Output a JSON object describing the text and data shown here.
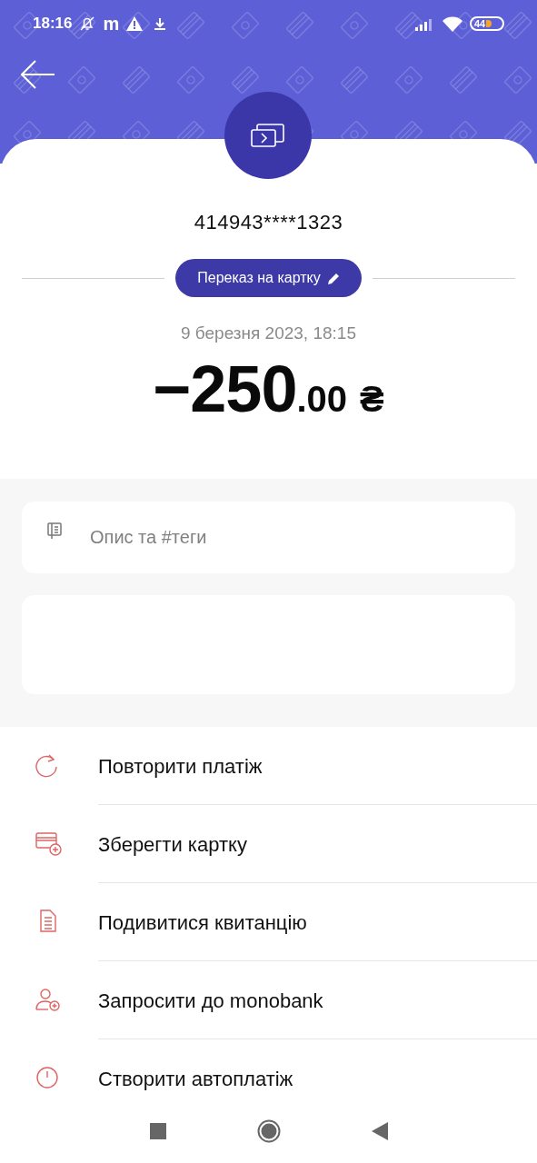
{
  "status_bar": {
    "time": "18:16",
    "notification_letter": "m",
    "battery": "44"
  },
  "transaction": {
    "card_number": "414943****1323",
    "category": "Переказ на картку",
    "date": "9 березня 2023, 18:15",
    "amount_whole": "−250",
    "amount_fraction": ".00",
    "currency": "₴"
  },
  "description_field": {
    "placeholder": "Опис та #теги"
  },
  "actions": [
    {
      "kind": "repeat",
      "label": "Повторити платіж"
    },
    {
      "kind": "save_card",
      "label": "Зберегти картку"
    },
    {
      "kind": "receipt",
      "label": "Подивитися квитанцію"
    },
    {
      "kind": "invite",
      "label": "Запросити до monobank"
    },
    {
      "kind": "autopay",
      "label": "Створити автоплатіж"
    }
  ]
}
